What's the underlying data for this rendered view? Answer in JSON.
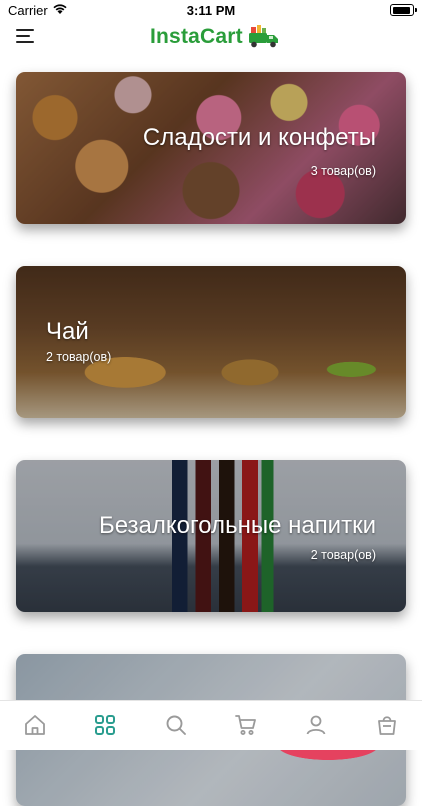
{
  "status_bar": {
    "carrier": "Carrier",
    "time": "3:11 PM"
  },
  "header": {
    "logo_text": "InstaCart",
    "brand_color": "#2a9d3a"
  },
  "categories": [
    {
      "title": "Сладости и конфеты",
      "count": "3 товар(ов)"
    },
    {
      "title": "Чай",
      "count": "2 товар(ов)"
    },
    {
      "title": "Безалкогольные напитки",
      "count": "2 товар(ов)"
    },
    {
      "title": "",
      "count": ""
    }
  ],
  "tab_bar": {
    "active_color": "#2a9d8f",
    "inactive_color": "#9a9a9a",
    "tabs": [
      {
        "icon": "home-icon",
        "active": false
      },
      {
        "icon": "grid-icon",
        "active": true
      },
      {
        "icon": "search-icon",
        "active": false
      },
      {
        "icon": "cart-icon",
        "active": false
      },
      {
        "icon": "user-icon",
        "active": false
      },
      {
        "icon": "bag-icon",
        "active": false
      }
    ]
  }
}
